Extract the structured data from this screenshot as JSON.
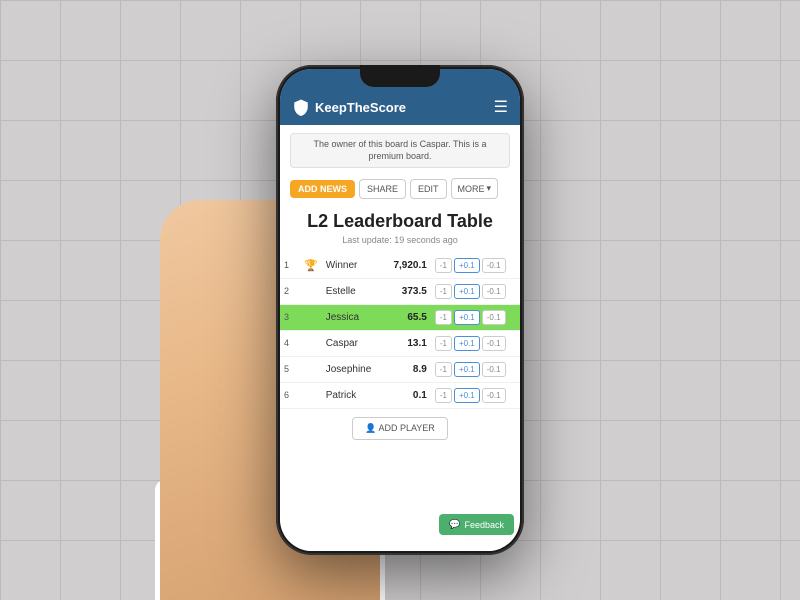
{
  "app": {
    "name": "KeepTheScore",
    "header_bg": "#2c5f8a"
  },
  "banner": {
    "text": "The owner of this board is Caspar. This is a premium board."
  },
  "toolbar": {
    "add_news_label": "ADD NEWS",
    "share_label": "SHARE",
    "edit_label": "EDIT",
    "more_label": "MORE"
  },
  "board": {
    "title": "L2 Leaderboard Table",
    "last_update": "Last update: 19 seconds ago"
  },
  "players": [
    {
      "rank": "1",
      "trophy": true,
      "name": "Winner",
      "score": "7,920.1",
      "highlighted": false
    },
    {
      "rank": "2",
      "trophy": false,
      "name": "Estelle",
      "score": "373.5",
      "highlighted": false
    },
    {
      "rank": "3",
      "trophy": false,
      "name": "Jessica",
      "score": "65.5",
      "highlighted": true
    },
    {
      "rank": "4",
      "trophy": false,
      "name": "Caspar",
      "score": "13.1",
      "highlighted": false
    },
    {
      "rank": "5",
      "trophy": false,
      "name": "Josephine",
      "score": "8.9",
      "highlighted": false
    },
    {
      "rank": "6",
      "trophy": false,
      "name": "Patrick",
      "score": "0.1",
      "highlighted": false
    }
  ],
  "score_buttons": {
    "minus": "-1",
    "plus": "+0.1",
    "minus_small": "-0.1"
  },
  "add_player_label": "ADD PLAYER",
  "feedback_label": "Feedback"
}
